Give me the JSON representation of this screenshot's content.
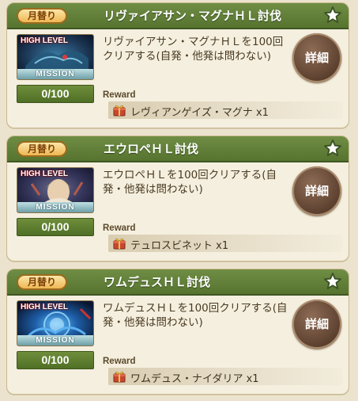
{
  "missions": [
    {
      "badge": "月替り",
      "title": "リヴァイアサン・マグナＨＬ討伐",
      "thumb_label": "HIGH LEVEL",
      "thumb_mission": "MISSION",
      "progress": "0/100",
      "description": "リヴァイアサン・マグナＨＬを100回クリアする(自発・他発は問わない)",
      "detail_label": "詳細",
      "reward_label": "Reward",
      "reward_item": "レヴィアンゲイズ・マグナ x1",
      "thumb_colors": [
        "#1f3d5c",
        "#2d6a8a",
        "#10223a"
      ]
    },
    {
      "badge": "月替り",
      "title": "エウロペＨＬ討伐",
      "thumb_label": "HIGH LEVEL",
      "thumb_mission": "MISSION",
      "progress": "0/100",
      "description": "エウロペＨＬを100回クリアする(自発・他発は問わない)",
      "detail_label": "詳細",
      "reward_label": "Reward",
      "reward_item": "テュロスビネット x1",
      "thumb_colors": [
        "#3a3b5e",
        "#c9b49a",
        "#232542"
      ]
    },
    {
      "badge": "月替り",
      "title": "ワムデュスＨＬ討伐",
      "thumb_label": "HIGH LEVEL",
      "thumb_mission": "MISSION",
      "progress": "0/100",
      "description": "ワムデュスＨＬを100回クリアする(自発・他発は問わない)",
      "detail_label": "詳細",
      "reward_label": "Reward",
      "reward_item": "ワムデュス・ナイダリア x1",
      "thumb_colors": [
        "#13294d",
        "#2f8bd6",
        "#0a1630"
      ]
    }
  ],
  "colors": {
    "header_green": "#5f7e37",
    "badge_orange": "#eeb653",
    "button_brown": "#5b3f2e",
    "progress_green": "#5f7e30"
  }
}
